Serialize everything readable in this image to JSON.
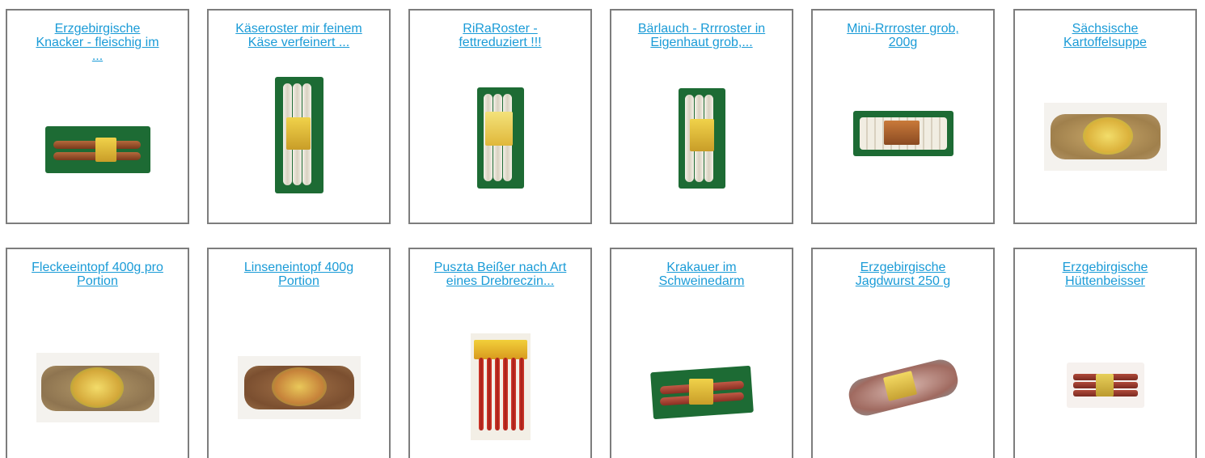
{
  "products": [
    {
      "title": "Erzgebirgische\nKnacker - fleischig im\n...",
      "image": "knacker-package"
    },
    {
      "title": "Käseroster mir feinem\nKäse verfeinert ...",
      "image": "kaeseroster-package"
    },
    {
      "title": "RiRaRoster -\nfettreduziert !!!",
      "image": "riraroster-package"
    },
    {
      "title": "Bärlauch - Rrrroster in\nEigenhaut grob,...",
      "image": "baerlauch-package"
    },
    {
      "title": "Mini-Rrrroster grob,\n200g ",
      "image": "mini-rrrroster-package"
    },
    {
      "title": "Sächsische\nKartoffelsuppe",
      "image": "kartoffelsuppe-package"
    },
    {
      "title": "Fleckeeintopf 400g pro\nPortion ",
      "image": "fleckeeintopf-package"
    },
    {
      "title": "Linseneintopf 400g\nPortion",
      "image": "linseneintopf-package"
    },
    {
      "title": "Puszta Beißer nach Art\neines Drebreczin...",
      "image": "puszta-package"
    },
    {
      "title": "Krakauer im\nSchweinedarm",
      "image": "krakauer-package"
    },
    {
      "title": "Erzgebirgische\nJagdwurst 250 g",
      "image": "jagdwurst-package"
    },
    {
      "title": "Erzgebirgische\nHüttenbeisser",
      "image": "huettenbeisser-package"
    }
  ],
  "colors": {
    "link": "#1a9bd7",
    "border": "#7d7d7d",
    "package_green": "#1d6b34"
  }
}
